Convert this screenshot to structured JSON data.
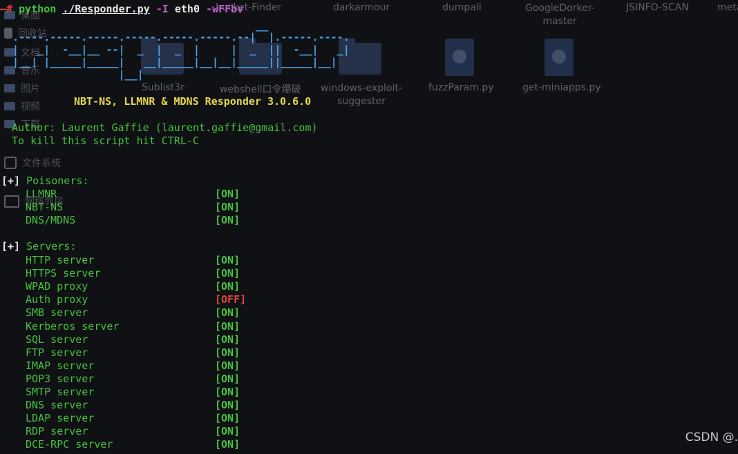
{
  "desktop": {
    "top_labels": [
      "bucket-Finder",
      "darkarmour",
      "dumpall",
      "GoogleDorker-master",
      "JSINFO-SCAN",
      "meta"
    ],
    "sidebar": [
      "桌面",
      "回收站",
      "文档",
      "音乐",
      "图片",
      "视频",
      "下载",
      "文件系统",
      "网络邻居"
    ],
    "files": [
      {
        "label": "Sublist3r",
        "kind": "folder-icon"
      },
      {
        "label": "webshell口令爆破",
        "kind": "folder-icon"
      },
      {
        "label": "windows-exploit-suggester",
        "kind": "folder-icon"
      },
      {
        "label": "fuzzParam.py",
        "kind": "python-file-icon"
      },
      {
        "label": "get-miniapps.py",
        "kind": "python-file-icon"
      }
    ]
  },
  "terminal": {
    "command": {
      "prompt": "—#",
      "program": "python",
      "script": "./Responder.py",
      "flag": "-I",
      "iface": "eth0",
      "opts": "-wFFbv"
    },
    "banner": [
      "                                         __",
      "  .----.-----.-----.-----.-----.-----.--|  |.-----.----.",
      "  |   _|  -__|__ --|  _  |  _  |     |  _  ||  -__|   _|",
      "  |__| |_____|_____|   __|_____|__|__|_____||_____|__|",
      "                   |__|"
    ],
    "title": "NBT-NS, LLMNR & MDNS Responder 3.0.6.0",
    "author": "Author: Laurent Gaffie (laurent.gaffie@gmail.com)",
    "kill": "To kill this script hit CTRL-C",
    "section_marker": "[+]",
    "poisoners_header": "Poisoners:",
    "poisoners": [
      {
        "name": "LLMNR",
        "status": "[ON]"
      },
      {
        "name": "NBT-NS",
        "status": "[ON]"
      },
      {
        "name": "DNS/MDNS",
        "status": "[ON]"
      }
    ],
    "servers_header": "Servers:",
    "servers": [
      {
        "name": "HTTP server",
        "status": "[ON]"
      },
      {
        "name": "HTTPS server",
        "status": "[ON]"
      },
      {
        "name": "WPAD proxy",
        "status": "[ON]"
      },
      {
        "name": "Auth proxy",
        "status": "[OFF]"
      },
      {
        "name": "SMB server",
        "status": "[ON]"
      },
      {
        "name": "Kerberos server",
        "status": "[ON]"
      },
      {
        "name": "SQL server",
        "status": "[ON]"
      },
      {
        "name": "FTP server",
        "status": "[ON]"
      },
      {
        "name": "IMAP server",
        "status": "[ON]"
      },
      {
        "name": "POP3 server",
        "status": "[ON]"
      },
      {
        "name": "SMTP server",
        "status": "[ON]"
      },
      {
        "name": "DNS server",
        "status": "[ON]"
      },
      {
        "name": "LDAP server",
        "status": "[ON]"
      },
      {
        "name": "RDP server",
        "status": "[ON]"
      },
      {
        "name": "DCE-RPC server",
        "status": "[ON]"
      }
    ]
  },
  "watermark": "CSDN @."
}
